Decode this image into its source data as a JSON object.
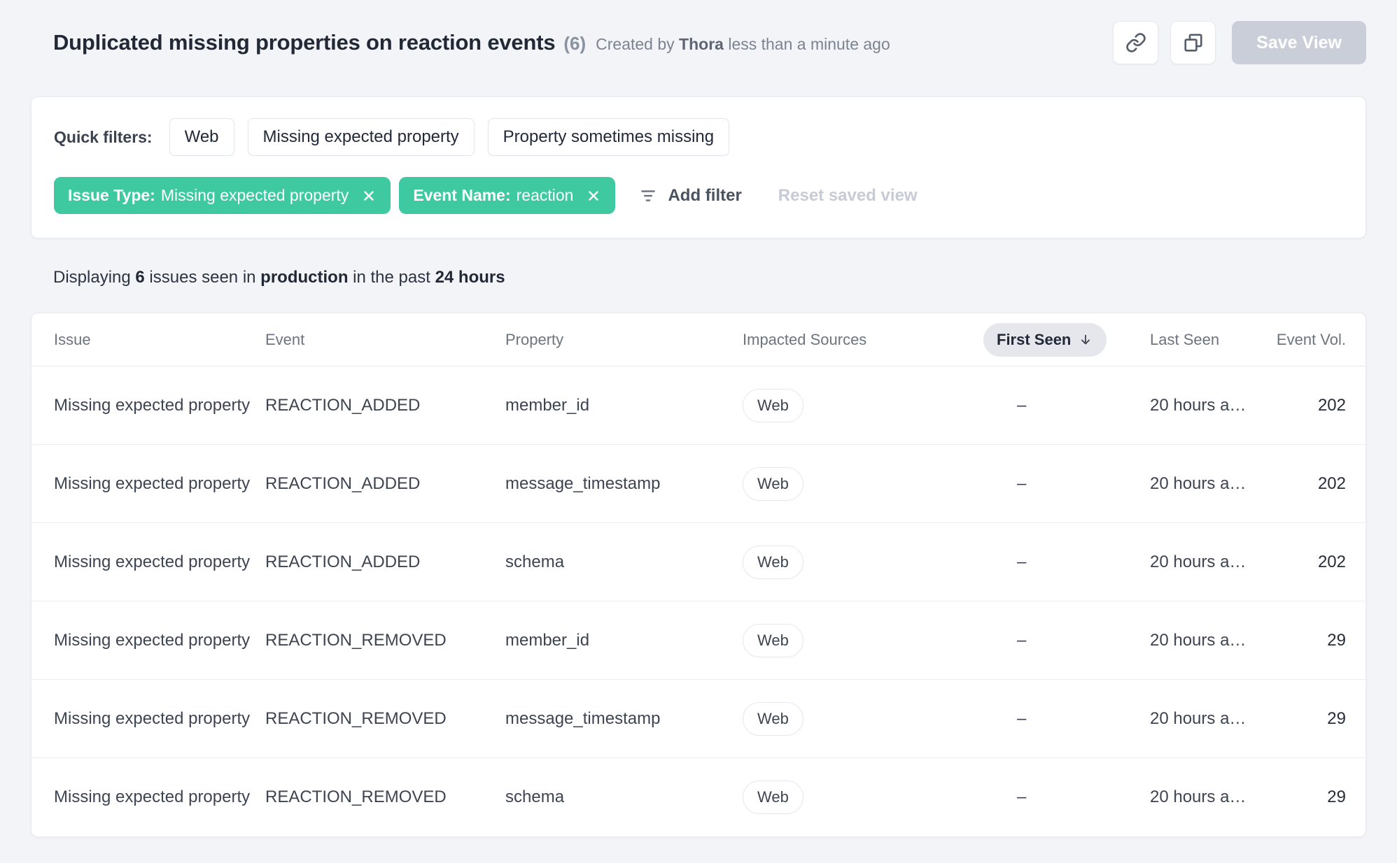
{
  "header": {
    "title": "Duplicated missing properties on reaction events",
    "count": "(6)",
    "created_by_prefix": "Created by ",
    "created_by_name": "Thora",
    "created_by_suffix": " less than a minute ago",
    "save_view_label": "Save View"
  },
  "filters": {
    "quick_filters_label": "Quick filters:",
    "quick_filters": [
      "Web",
      "Missing expected property",
      "Property sometimes missing"
    ],
    "active_filters": [
      {
        "label": "Issue Type:",
        "value": "Missing expected property"
      },
      {
        "label": "Event Name:",
        "value": "reaction"
      }
    ],
    "add_filter_label": "Add filter",
    "reset_label": "Reset saved view"
  },
  "summary": {
    "text1": "Displaying ",
    "bold1": "6",
    "text2": " issues seen in ",
    "bold2": "production",
    "text3": " in the past ",
    "bold3": "24 hours"
  },
  "table": {
    "columns": {
      "issue": "Issue",
      "event": "Event",
      "property": "Property",
      "sources": "Impacted Sources",
      "first_seen": "First Seen",
      "last_seen": "Last Seen",
      "event_vol": "Event Vol."
    },
    "sort": {
      "column": "First Seen",
      "direction": "desc"
    },
    "rows": [
      {
        "issue": "Missing expected property",
        "event": "REACTION_ADDED",
        "property": "member_id",
        "source": "Web",
        "first_seen": "–",
        "last_seen": "20 hours a…",
        "event_vol": "202"
      },
      {
        "issue": "Missing expected property",
        "event": "REACTION_ADDED",
        "property": "message_timestamp",
        "source": "Web",
        "first_seen": "–",
        "last_seen": "20 hours a…",
        "event_vol": "202"
      },
      {
        "issue": "Missing expected property",
        "event": "REACTION_ADDED",
        "property": "schema",
        "source": "Web",
        "first_seen": "–",
        "last_seen": "20 hours a…",
        "event_vol": "202"
      },
      {
        "issue": "Missing expected property",
        "event": "REACTION_REMOVED",
        "property": "member_id",
        "source": "Web",
        "first_seen": "–",
        "last_seen": "20 hours a…",
        "event_vol": "29"
      },
      {
        "issue": "Missing expected property",
        "event": "REACTION_REMOVED",
        "property": "message_timestamp",
        "source": "Web",
        "first_seen": "–",
        "last_seen": "20 hours a…",
        "event_vol": "29"
      },
      {
        "issue": "Missing expected property",
        "event": "REACTION_REMOVED",
        "property": "schema",
        "source": "Web",
        "first_seen": "–",
        "last_seen": "20 hours a…",
        "event_vol": "29"
      }
    ]
  },
  "icons": {
    "share_link": "link-icon",
    "copy": "copy-icon",
    "filter": "filter-icon",
    "sort_down": "arrow-down-icon",
    "close": "close-icon"
  },
  "colors": {
    "accent_green": "#3ec9a1",
    "page_background": "#f3f4f8",
    "card_background": "#ffffff",
    "disabled_button": "#c9ced9",
    "sort_pill_background": "#e5e7ec",
    "text_dark": "#222936",
    "text_muted": "#7b8391"
  }
}
